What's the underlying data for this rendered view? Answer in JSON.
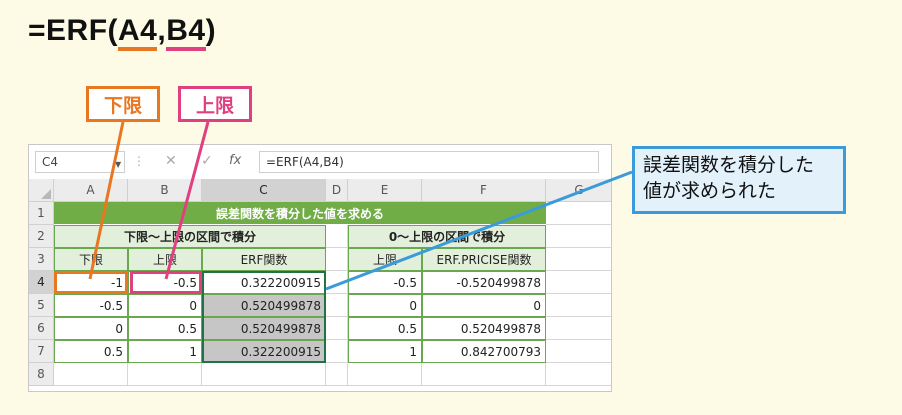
{
  "heading": {
    "prefix": "=ERF(",
    "arg1": "A4",
    "comma": ",",
    "arg2": "B4",
    "suffix": ")"
  },
  "callouts": {
    "lower": "下限",
    "upper": "上限"
  },
  "note": {
    "line1": "誤差関数を積分した",
    "line2": "値が求められた"
  },
  "formula_bar": {
    "name_box": "C4",
    "cancel": "✕",
    "confirm": "✓",
    "fx": "fx",
    "formula": "=ERF(A4,B4)"
  },
  "columns": [
    "A",
    "B",
    "C",
    "D",
    "E",
    "F",
    "G"
  ],
  "rows": [
    "1",
    "2",
    "3",
    "4",
    "5",
    "6",
    "7",
    "8"
  ],
  "sheet": {
    "title": "誤差関数を積分した値を求める",
    "left_header": "下限～上限の区間で積分",
    "right_header": "0～上限の区間で積分",
    "col_lower": "下限",
    "col_upper": "上限",
    "col_erf": "ERF関数",
    "col_upper2": "上限",
    "col_precise": "ERF.PRICISE関数",
    "left_rows": [
      {
        "a": "-1",
        "b": "-0.5",
        "c": "0.322200915"
      },
      {
        "a": "-0.5",
        "b": "0",
        "c": "0.520499878"
      },
      {
        "a": "0",
        "b": "0.5",
        "c": "0.520499878"
      },
      {
        "a": "0.5",
        "b": "1",
        "c": "0.322200915"
      }
    ],
    "right_rows": [
      {
        "e": "-0.5",
        "f": "-0.520499878"
      },
      {
        "e": "0",
        "f": "0"
      },
      {
        "e": "0.5",
        "f": "0.520499878"
      },
      {
        "e": "1",
        "f": "0.842700793"
      }
    ]
  },
  "colors": {
    "orange": "#e87722",
    "pink": "#e0407f",
    "blue": "#3b9ad9",
    "green": "#70ad47"
  }
}
